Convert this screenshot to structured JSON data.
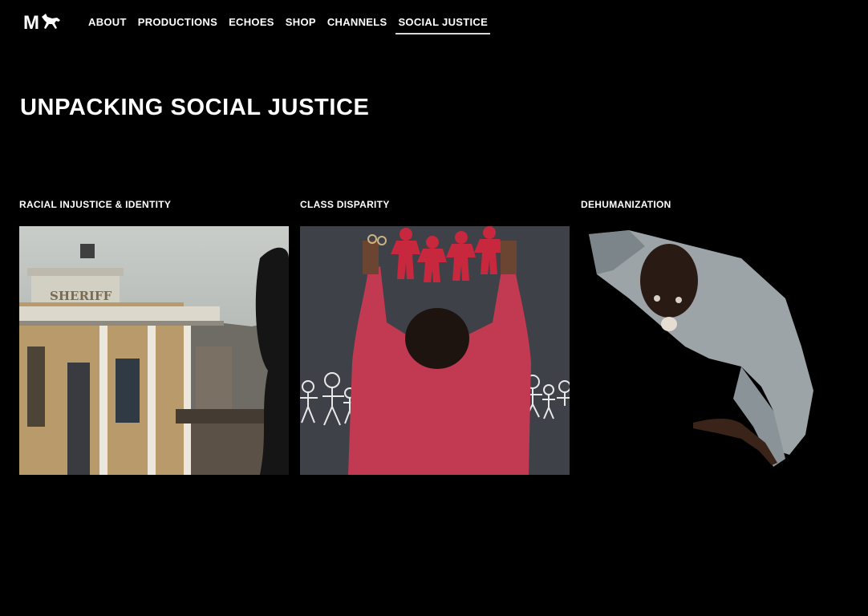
{
  "nav": {
    "logo_text": "M",
    "links": [
      {
        "label": "ABOUT"
      },
      {
        "label": "PRODUCTIONS"
      },
      {
        "label": "ECHOES"
      },
      {
        "label": "SHOP"
      },
      {
        "label": "CHANNELS"
      },
      {
        "label": "SOCIAL JUSTICE",
        "active": true
      }
    ]
  },
  "page": {
    "title": "UNPACKING SOCIAL JUSTICE"
  },
  "cards": [
    {
      "title": "RACIAL INJUSTICE & IDENTITY",
      "image_sign": "SHERIFF"
    },
    {
      "title": "CLASS DISPARITY"
    },
    {
      "title": "DEHUMANIZATION"
    }
  ],
  "colors": {
    "background": "#000000",
    "text": "#ffffff",
    "accent_red": "#c8283d"
  },
  "icons": [
    "logo-horse-icon"
  ]
}
